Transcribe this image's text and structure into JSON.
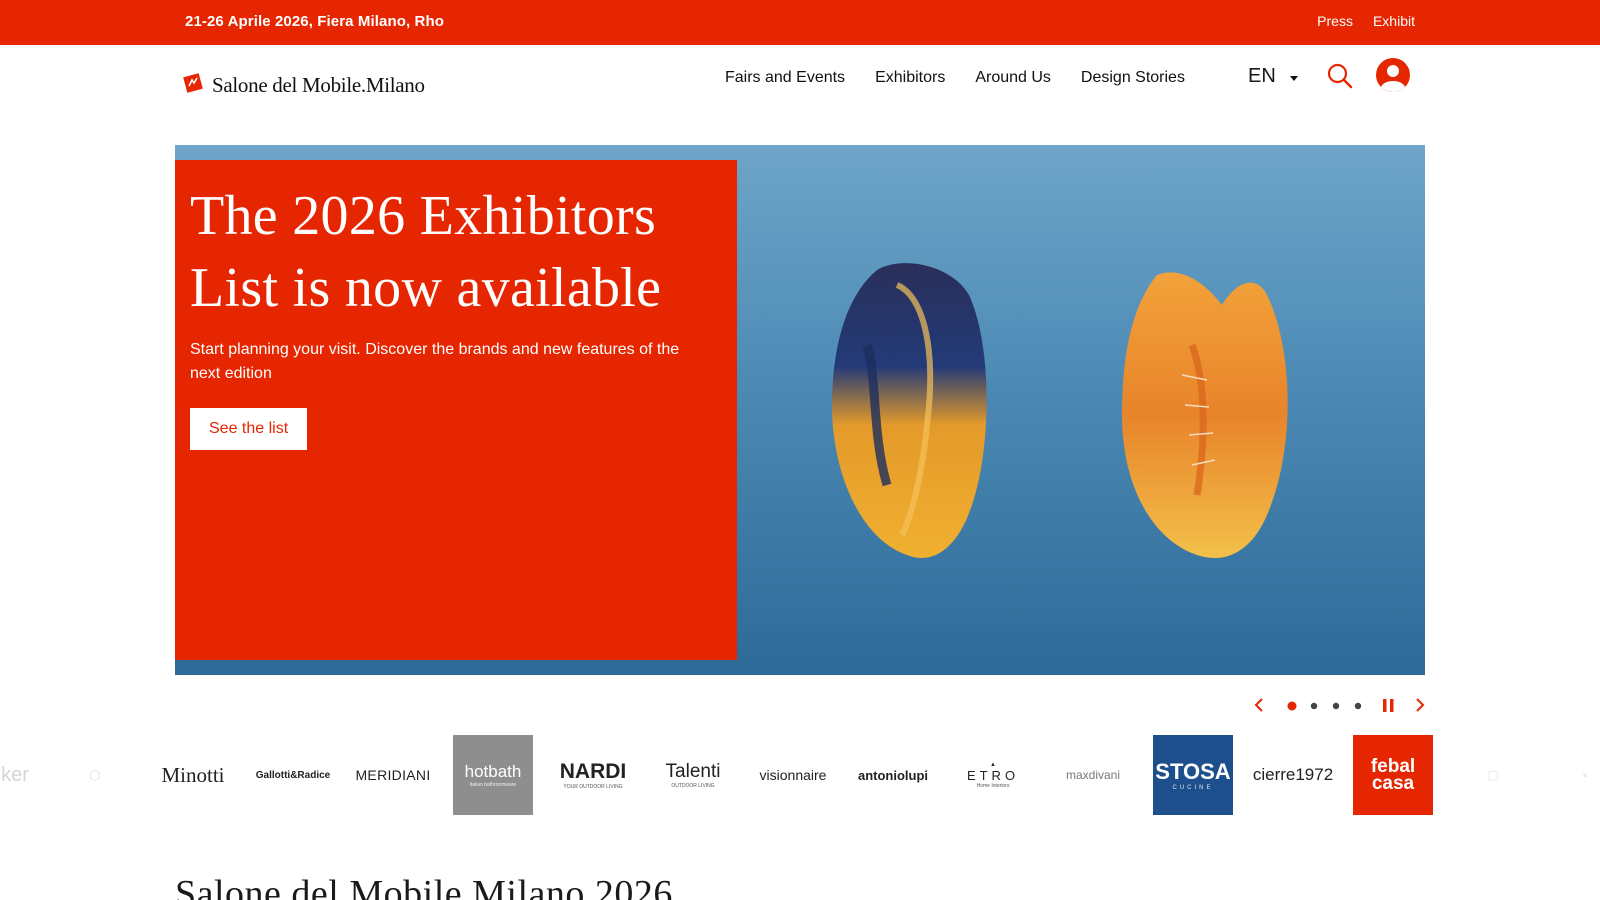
{
  "topbar": {
    "event_info": "21-26 Aprile 2026, Fiera Milano, Rho",
    "links": [
      "Press",
      "Exhibit"
    ]
  },
  "header": {
    "logo_text": "Salone del Mobile.Milano",
    "nav": [
      "Fairs and Events",
      "Exhibitors",
      "Around Us",
      "Design Stories"
    ],
    "language": "EN",
    "icons": [
      "search-icon",
      "user-icon"
    ]
  },
  "hero": {
    "title_line1": "The 2026 Exhibitors",
    "title_line2": "List is now available",
    "subtitle": "Start planning your visit. Discover the brands and new features of the next edition",
    "button": "See the list",
    "slide_count": 4,
    "active_slide": 1
  },
  "brands": [
    "Minotti",
    "Gallotti&Radice",
    "MERIDIANI",
    "hotbath",
    "italian bathroomware",
    "NARDI",
    "YOUR OUTDOOR LIVING",
    "Talenti",
    "OUTDOOR LIVING",
    "visionnaire",
    "antoniolupi",
    "ETRO",
    "Home Interiors",
    "maxdivani",
    "STOSA",
    "CUCINE",
    "cierre1972",
    "febal",
    "casa"
  ],
  "section": {
    "title": "Salone del Mobile.Milano 2026"
  },
  "colors": {
    "brand_red": "#e62600",
    "hero_blue": "#4c8ab5",
    "stosa_blue": "#1d4f8c"
  }
}
